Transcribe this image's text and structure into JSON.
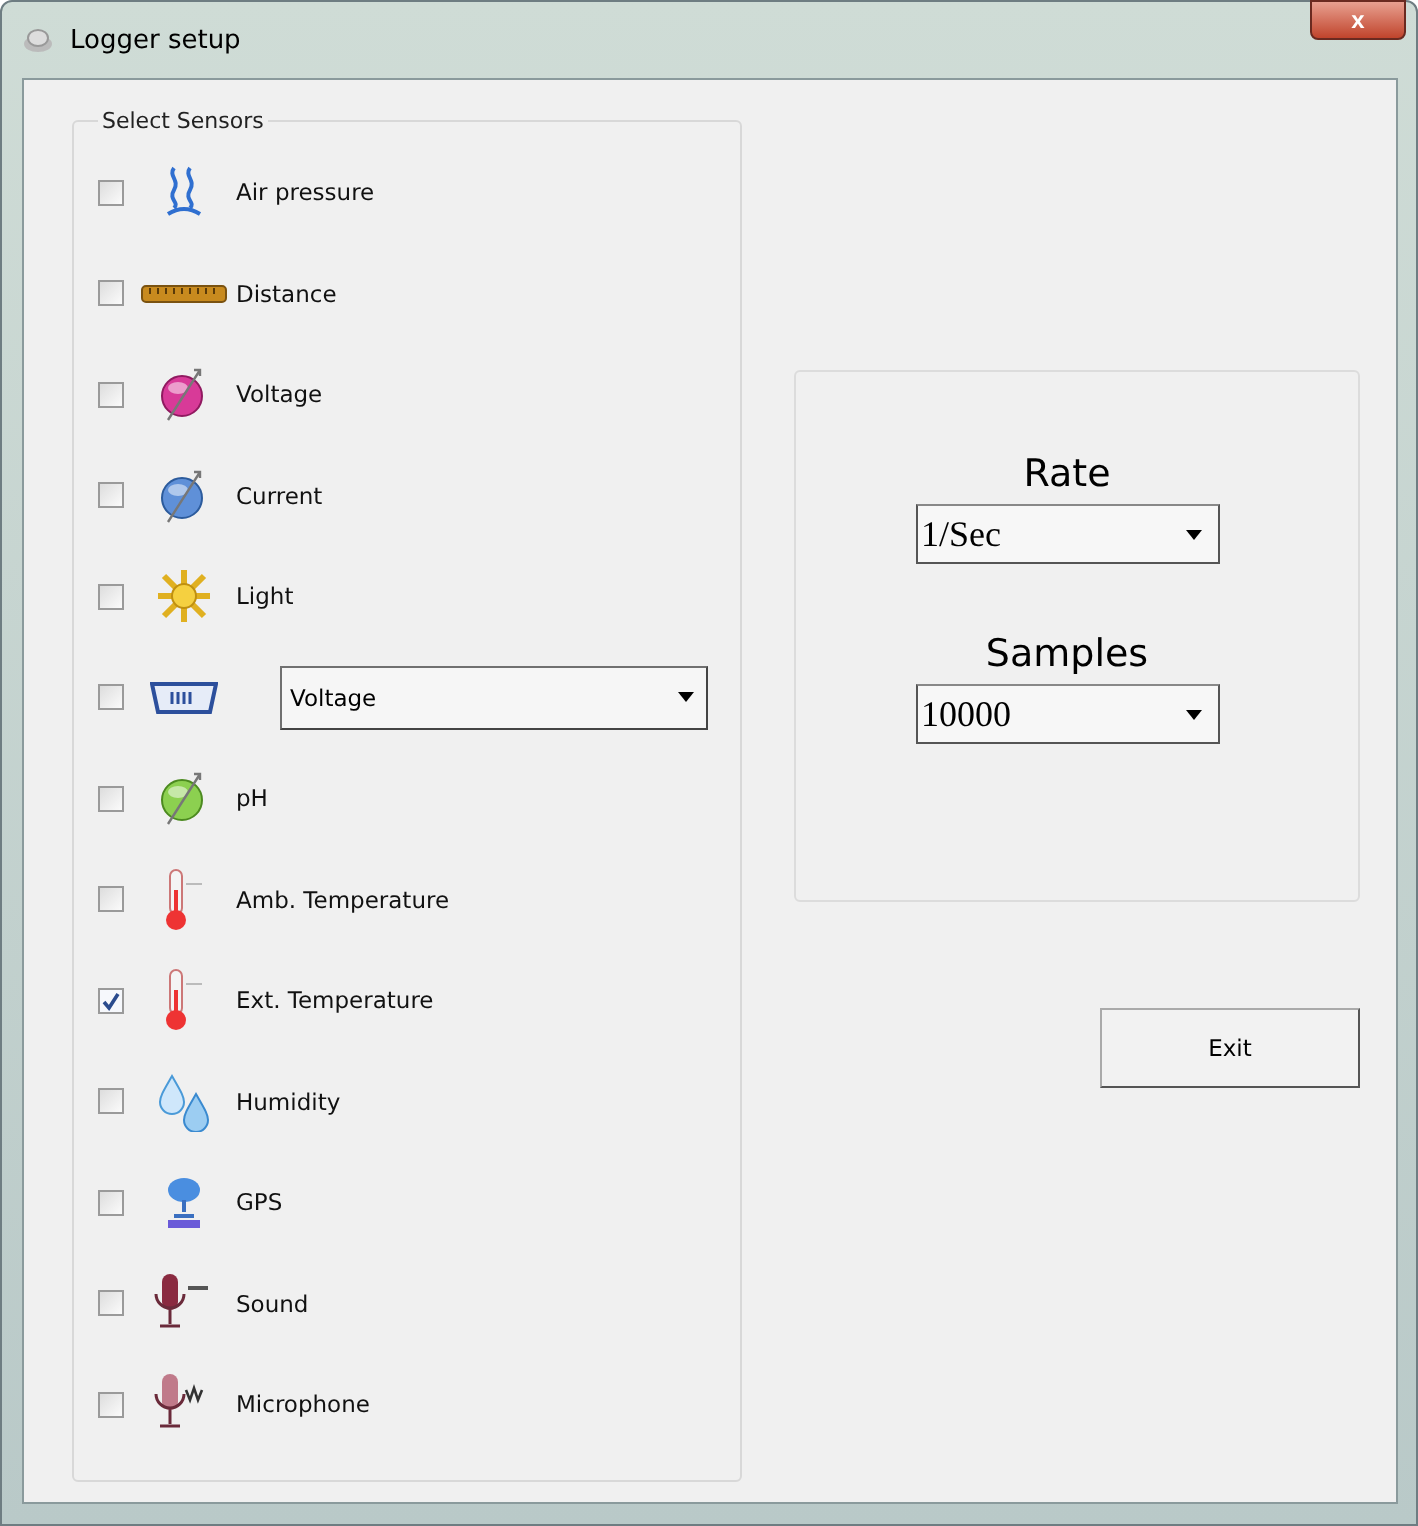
{
  "window": {
    "title": "Logger setup",
    "close": "x"
  },
  "sensors_group": {
    "title": "Select Sensors",
    "items": [
      {
        "kind": "label",
        "label": "Air pressure",
        "checked": false
      },
      {
        "kind": "label",
        "label": "Distance",
        "checked": false
      },
      {
        "kind": "label",
        "label": "Voltage",
        "checked": false
      },
      {
        "kind": "label",
        "label": "Current",
        "checked": false
      },
      {
        "kind": "label",
        "label": "Light",
        "checked": false
      },
      {
        "kind": "select",
        "value": "Voltage",
        "checked": false
      },
      {
        "kind": "label",
        "label": "pH",
        "checked": false
      },
      {
        "kind": "label",
        "label": "Amb. Temperature",
        "checked": false
      },
      {
        "kind": "label",
        "label": "Ext. Temperature",
        "checked": true
      },
      {
        "kind": "label",
        "label": "Humidity",
        "checked": false
      },
      {
        "kind": "label",
        "label": "GPS",
        "checked": false
      },
      {
        "kind": "label",
        "label": "Sound",
        "checked": false
      },
      {
        "kind": "label",
        "label": "Microphone",
        "checked": false
      }
    ]
  },
  "settings": [
    {
      "label": "Rate",
      "value": "1/Sec"
    },
    {
      "label": "Samples",
      "value": "10000"
    }
  ],
  "buttons": [
    "Exit"
  ]
}
